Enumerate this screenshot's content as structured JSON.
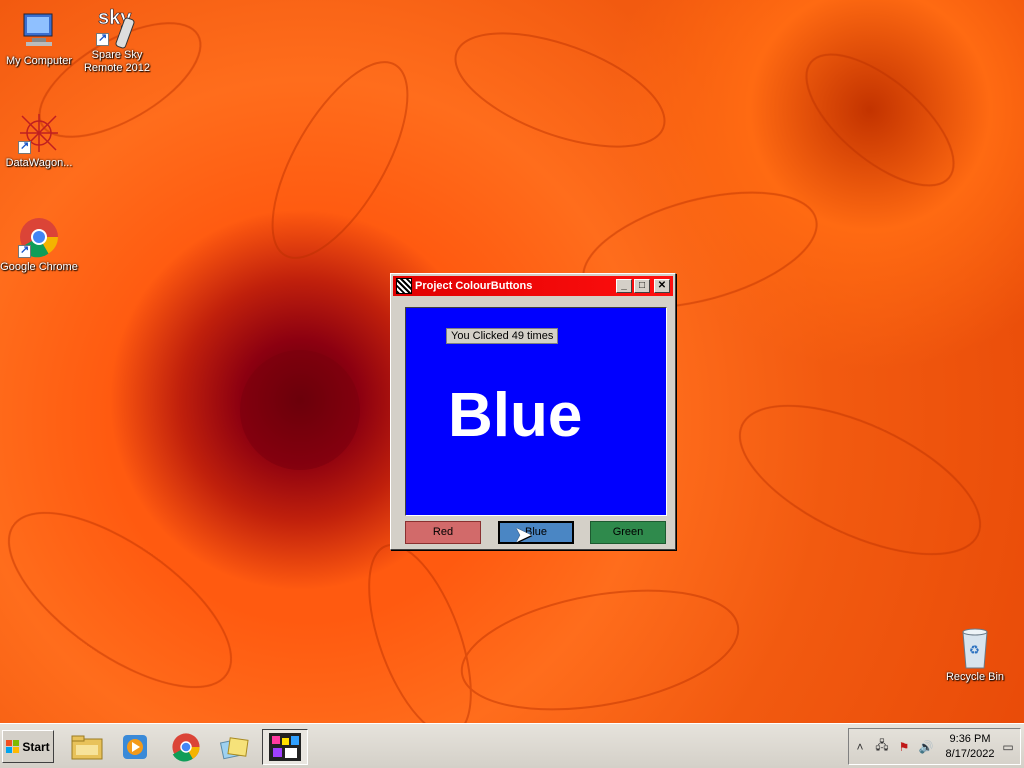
{
  "desktop": {
    "icons": [
      {
        "label": "My Computer"
      },
      {
        "label": "Spare Sky Remote 2012",
        "logo_text": "sky"
      },
      {
        "label": "DataWagon..."
      },
      {
        "label": "Google Chrome"
      },
      {
        "label": "Recycle Bin"
      }
    ]
  },
  "window": {
    "title": "Project ColourButtons",
    "controls": {
      "minimize": "_",
      "maximize": "□",
      "close": "✕"
    },
    "canvas_color": "#0000ff",
    "counter_text": "You Clicked 49 times",
    "big_text": "Blue",
    "buttons": [
      {
        "label": "Red",
        "color": "#d26a6a"
      },
      {
        "label": "Blue",
        "color": "#4a86c4"
      },
      {
        "label": "Green",
        "color": "#2f8a4c"
      }
    ]
  },
  "taskbar": {
    "start_label": "Start",
    "items": [
      "file-explorer-icon",
      "media-player-icon",
      "chrome-icon",
      "folders-icon",
      "colourbuttons-app-icon"
    ],
    "tray": {
      "icons": [
        "show-hidden-icons",
        "network-icon",
        "action-center-icon",
        "volume-icon"
      ],
      "time": "9:36 PM",
      "date": "8/17/2022"
    }
  }
}
